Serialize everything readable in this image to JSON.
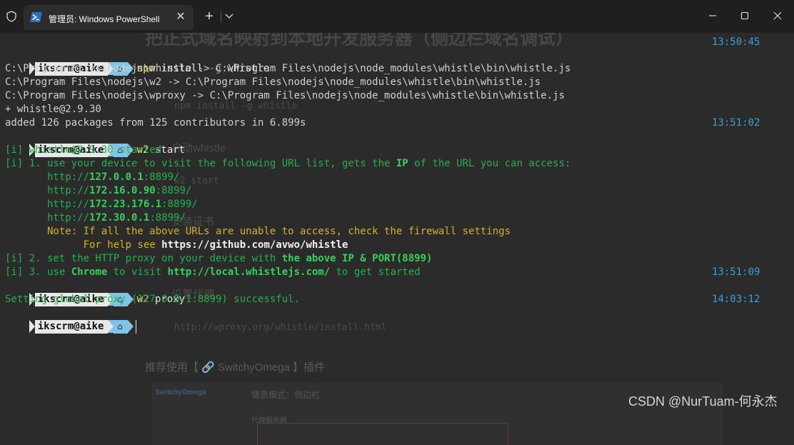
{
  "window": {
    "tab_title": "管理员: Windows PowerShell",
    "tab_close": "✕",
    "new_tab": "+"
  },
  "prompt": {
    "user": "ikscrm@aike",
    "home": "⌂"
  },
  "lines": {
    "cmd1": {
      "name": "npm",
      "rest1": " install ",
      "flag": "-g",
      "rest2": " whistle"
    },
    "l2": "C:\\Program Files\\nodejs\\whistle -> C:\\Program Files\\nodejs\\node_modules\\whistle\\bin\\whistle.js",
    "l3": "C:\\Program Files\\nodejs\\w2 -> C:\\Program Files\\nodejs\\node_modules\\whistle\\bin\\whistle.js",
    "l4": "C:\\Program Files\\nodejs\\wproxy -> C:\\Program Files\\nodejs\\node_modules\\whistle\\bin\\whistle.js",
    "l5": "+ whistle@2.9.30",
    "l6": "added 126 packages from 125 contributors in 6.899s",
    "cmd2": {
      "name": "w2",
      "rest": " start"
    },
    "l8": "[i] whistle@2.9.30 started",
    "l9_a": "[i] 1. use your device to visit the following URL list, gets the ",
    "l9_ip": "IP",
    "l9_b": " of the URL you can access:",
    "urls": [
      {
        "proto": "       http://",
        "host": "127.0.0.1",
        "port": ":8899/"
      },
      {
        "proto": "       http://",
        "host": "172.16.0.90",
        "port": ":8899/"
      },
      {
        "proto": "       http://",
        "host": "172.23.176.1",
        "port": ":8899/"
      },
      {
        "proto": "       http://",
        "host": "172.30.0.1",
        "port": ":8899/"
      }
    ],
    "note": "       Note: If all the above URLs are unable to access, check the firewall settings",
    "help_a": "             For help see ",
    "help_url": "https://github.com/avwo/whistle",
    "l16_a": "[i] 2. set the HTTP proxy on your device with ",
    "l16_b": "the above IP & PORT(8899)",
    "l17_a": "[i] 3. use ",
    "l17_chrome": "Chrome",
    "l17_b": " to visit ",
    "l17_url": "http://local.whistlejs.com/",
    "l17_c": " to get started",
    "cmd3": {
      "name": "w2",
      "rest": " proxy"
    },
    "l19": "Setting global proxy (127.0.0.1:8899) successful."
  },
  "times": {
    "t1": "13:50:45",
    "t2": "13:51:02",
    "t3": "13:51:09",
    "t4": "14:03:12"
  },
  "background_page": {
    "title": "把正式域名映射到本地开发服务器（侧边栏域名调试）",
    "b1": "npm install -g whistle",
    "b2": "启动whistle",
    "b3": "w2 start",
    "b4": "安装证书",
    "b5": "设置代理",
    "b6": "http://wproxy.org/whistle/install.html",
    "b7": "推荐使用【 🔗 SwitchyOmega 】插件",
    "card_brand": "SwitchyOmega",
    "card_mode": "情景模式：侧边栏",
    "card_section": "代理服务器"
  },
  "watermark": "CSDN @NurTuam-何永杰"
}
